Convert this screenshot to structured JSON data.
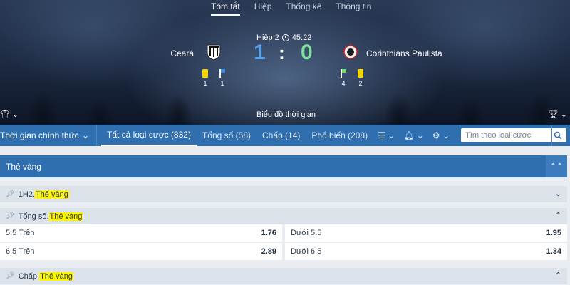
{
  "top_tabs": [
    "Tóm tắt",
    "Hiệp",
    "Thống kê",
    "Thông tin"
  ],
  "match": {
    "period": "Hiệp 2",
    "clock": "45:22",
    "home_team": "Ceará",
    "away_team": "Corinthians Paulista",
    "home_score": "1",
    "separator": ":",
    "away_score": "0",
    "home_stats": {
      "yellow_cards": "1",
      "corners": "1"
    },
    "away_stats": {
      "corners": "4",
      "yellow_cards": "2"
    },
    "timeline_label": "Biểu đồ thời gian"
  },
  "navbar": {
    "time_select": "Thời gian chính thức",
    "tabs": [
      "Tất cả loại cược (832)",
      "Tổng số (58)",
      "Chấp (14)",
      "Phổ biến (208)"
    ],
    "search_placeholder": "Tìm theo loại cược"
  },
  "market_header": "Thẻ vàng",
  "groups": {
    "g1": {
      "prefix": "1H2. ",
      "highlight": "Thẻ vàng"
    },
    "g2": {
      "prefix": "Tổng số. ",
      "highlight": "Thẻ vàng"
    },
    "g3": {
      "prefix": "Chấp. ",
      "highlight": "Thẻ vàng"
    }
  },
  "odds": [
    {
      "left_label": "5.5 Trên",
      "left_price": "1.76",
      "right_label": "Dưới 5.5",
      "right_price": "1.95"
    },
    {
      "left_label": "6.5 Trên",
      "left_price": "2.89",
      "right_label": "Dưới 6.5",
      "right_price": "1.34"
    }
  ],
  "colors": {
    "accent_blue": "#2f6fb0",
    "score_home": "#5aa2ee",
    "score_away": "#7fe0a0",
    "yellow_card": "#f2d600",
    "highlight": "#fff500"
  },
  "icons": [
    "clock-icon",
    "yellow-card-icon",
    "corner-flag-icon",
    "shirt-icon",
    "trophy-icon",
    "list-icon",
    "bell-icon",
    "gear-icon",
    "search-icon",
    "chevron-down-icon",
    "chevron-up-icon",
    "pin-icon"
  ]
}
